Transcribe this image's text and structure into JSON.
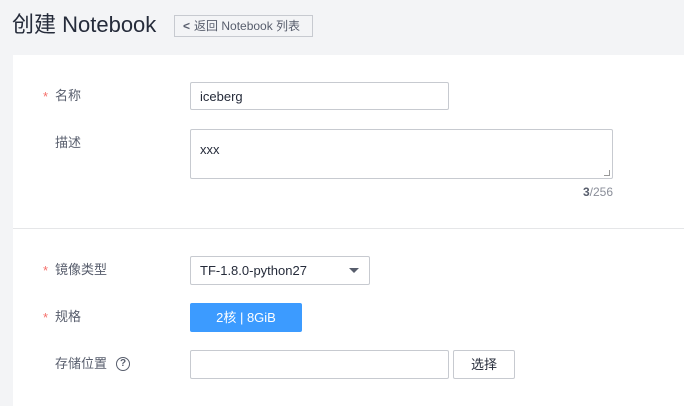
{
  "header": {
    "title": "创建 Notebook",
    "back_label": "返回 Notebook 列表"
  },
  "form": {
    "required_mark": "*",
    "name": {
      "label": "名称",
      "value": "iceberg"
    },
    "description": {
      "label": "描述",
      "value": "xxx",
      "count": "3",
      "max": "/256"
    },
    "image_type": {
      "label": "镜像类型",
      "value": "TF-1.8.0-python27"
    },
    "spec": {
      "label": "规格",
      "value": "2核 | 8GiB"
    },
    "storage": {
      "label": "存储位置",
      "value": "",
      "select_label": "选择"
    }
  },
  "colors": {
    "accent": "#3c9bff",
    "required": "#f66f6a"
  }
}
